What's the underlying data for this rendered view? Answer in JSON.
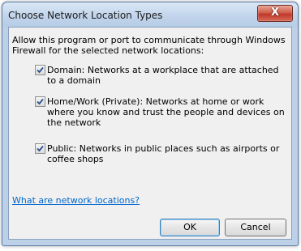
{
  "dialog": {
    "title": "Choose Network Location Types",
    "close_label": "X",
    "intro": "Allow this program or port to communicate through Windows Firewall for the selected network locations:",
    "options": [
      {
        "checked": true,
        "label": "Domain: Networks at a workplace that are attached to a domain"
      },
      {
        "checked": true,
        "label": "Home/Work (Private): Networks at home or work where you know and trust the people and devices on the network"
      },
      {
        "checked": true,
        "label": "Public: Networks in public places such as airports or coffee shops"
      }
    ],
    "link": "What are network locations?",
    "ok_label": "OK",
    "cancel_label": "Cancel"
  }
}
